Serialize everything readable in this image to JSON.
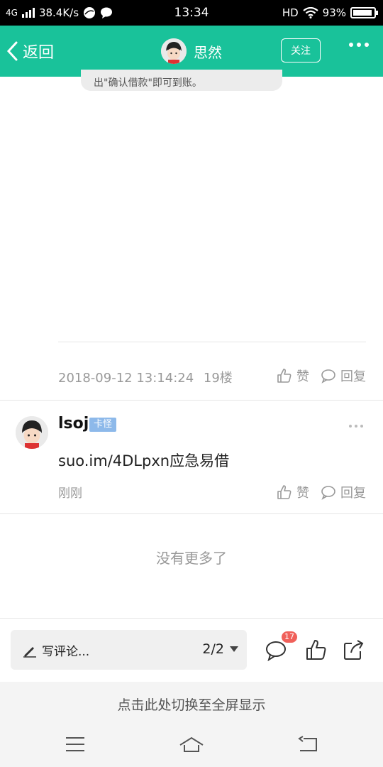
{
  "status": {
    "network": "4G",
    "speed": "38.4K/s",
    "time": "13:34",
    "hd": "HD",
    "battery": "93%",
    "battery_level": 0.93
  },
  "header": {
    "back_label": "返回",
    "title": "思然",
    "follow_label": "关注"
  },
  "post": {
    "bubble_text": "出\"确认借款\"即可到账。",
    "timestamp": "2018-09-12 13:14:24",
    "floor": "19楼",
    "like_label": "赞",
    "reply_label": "回复"
  },
  "comment": {
    "username": "lsoj",
    "badge": "卡怪",
    "text": "suo.im/4DLpxn应急易借",
    "time": "刚刚",
    "like_label": "赞",
    "reply_label": "回复"
  },
  "list": {
    "end_text": "没有更多了"
  },
  "bottom": {
    "write_placeholder": "写评论...",
    "page_indicator": "2/2",
    "comment_count": "17"
  },
  "fullscreen": {
    "text": "点击此处切换至全屏显示"
  },
  "colors": {
    "header": "#19c29a",
    "badge": "#8db9ea",
    "count_badge": "#f0605a"
  }
}
